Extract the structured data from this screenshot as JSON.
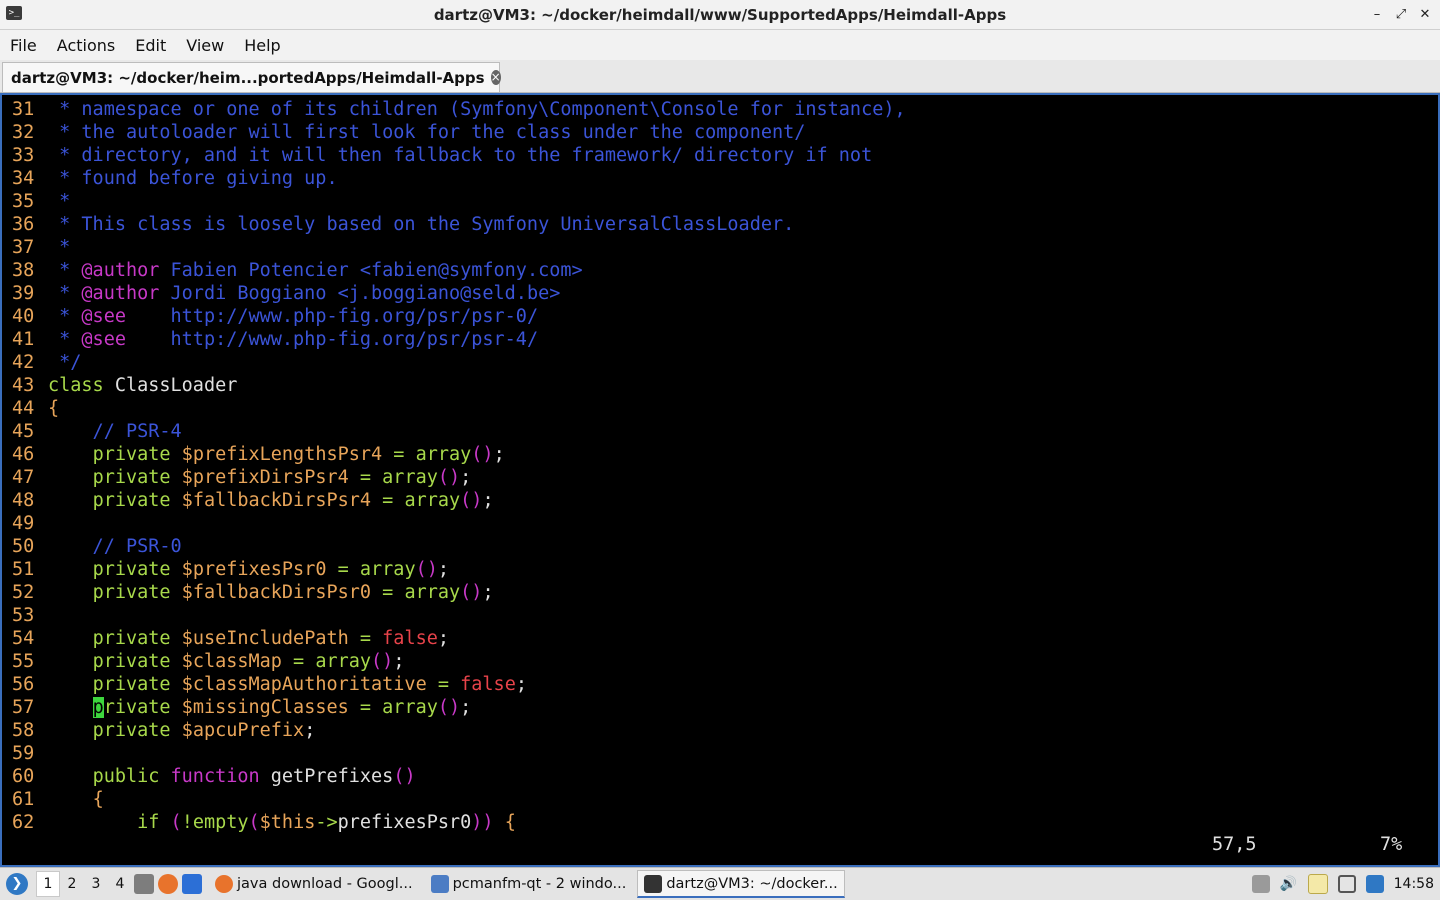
{
  "window": {
    "title": "dartz@VM3: ~/docker/heimdall/www/SupportedApps/Heimdall-Apps",
    "app_icon": "terminal-icon"
  },
  "menu": [
    "File",
    "Actions",
    "Edit",
    "View",
    "Help"
  ],
  "tab": {
    "label": "dartz@VM3: ~/docker/heim...portedApps/Heimdall-Apps"
  },
  "editor": {
    "lines": {
      "l31": {
        "n": "31",
        "c": " * namespace or one of its children (Symfony\\Component\\Console for instance),"
      },
      "l32": {
        "n": "32",
        "c": " * the autoloader will first look for the class under the component/"
      },
      "l33": {
        "n": "33",
        "c": " * directory, and it will then fallback to the framework/ directory if not"
      },
      "l34": {
        "n": "34",
        "c": " * found before giving up."
      },
      "l35": {
        "n": "35",
        "c": " *"
      },
      "l36": {
        "n": "36",
        "c": " * This class is loosely based on the Symfony UniversalClassLoader."
      },
      "l37": {
        "n": "37",
        "c": " *"
      },
      "l38": {
        "n": "38",
        "star": " * ",
        "tag": "@author",
        "rest": " Fabien Potencier <fabien@symfony.com>"
      },
      "l39": {
        "n": "39",
        "star": " * ",
        "tag": "@author",
        "rest": " Jordi Boggiano <j.boggiano@seld.be>"
      },
      "l40": {
        "n": "40",
        "star": " * ",
        "tag": "@see",
        "rest": "    http://www.php-fig.org/psr/psr-0/"
      },
      "l41": {
        "n": "41",
        "star": " * ",
        "tag": "@see",
        "rest": "    http://www.php-fig.org/psr/psr-4/"
      },
      "l42": {
        "n": "42",
        "c": " */"
      },
      "l43": {
        "n": "43",
        "kw": "class",
        "rest": " ClassLoader"
      },
      "l44": {
        "n": "44",
        "brace": "{"
      },
      "l45": {
        "n": "45",
        "c": "    // PSR-4"
      },
      "l46": {
        "n": "46",
        "kw": "private",
        "var": "prefixLengthsPsr4"
      },
      "l47": {
        "n": "47",
        "kw": "private",
        "var": "prefixDirsPsr4"
      },
      "l48": {
        "n": "48",
        "kw": "private",
        "var": "fallbackDirsPsr4"
      },
      "l49": {
        "n": "49"
      },
      "l50": {
        "n": "50",
        "c": "    // PSR-0"
      },
      "l51": {
        "n": "51",
        "kw": "private",
        "var": "prefixesPsr0"
      },
      "l52": {
        "n": "52",
        "kw": "private",
        "var": "fallbackDirsPsr0"
      },
      "l53": {
        "n": "53"
      },
      "l54": {
        "n": "54",
        "kw": "private",
        "var": "useIncludePath",
        "val": "false"
      },
      "l55": {
        "n": "55",
        "kw": "private",
        "var": "classMap"
      },
      "l56": {
        "n": "56",
        "kw": "private",
        "var": "classMapAuthoritative",
        "val": "false"
      },
      "l57": {
        "n": "57",
        "cursor_char": "p",
        "kw_rest": "rivate",
        "var": "missingClasses"
      },
      "l58": {
        "n": "58",
        "kw": "private",
        "var": "apcuPrefix"
      },
      "l59": {
        "n": "59"
      },
      "l60": {
        "n": "60",
        "kw": "public",
        "fn": "function",
        "name": "getPrefixes"
      },
      "l61": {
        "n": "61",
        "brace": "{"
      },
      "l62": {
        "n": "62",
        "kw": "if",
        "rest": "!empty",
        "var": "this",
        "name": "prefixesPsr0"
      }
    },
    "tokens": {
      "dollar": "$",
      "array_call": "array",
      "parens": "()",
      "assign": " = ",
      "semi": ";",
      "space": " ",
      "indent": "    ",
      "open_paren": " (",
      "arrow": "->",
      "close": "))",
      "open_brace": " {"
    },
    "status": {
      "position": "57,5",
      "percent": "7%"
    }
  },
  "taskbar": {
    "desktops": [
      "1",
      "2",
      "3",
      "4"
    ],
    "active_desktop": "1",
    "tasks": [
      {
        "label": "java download - Googl...",
        "icon": "firefox-icon"
      },
      {
        "label": "pcmanfm-qt - 2 windo...",
        "icon": "folder-icon"
      },
      {
        "label": "dartz@VM3: ~/docker...",
        "icon": "terminal-icon"
      }
    ],
    "clock": "14:58"
  },
  "colors": {
    "comment": "#3b54d8",
    "doc_tag": "#c839c8",
    "keyword": "#a8d94b",
    "variable": "#e8a55a",
    "boolean": "#e8434a",
    "cursor": "#3dd63d",
    "terminal_border": "#3a6ebd"
  }
}
